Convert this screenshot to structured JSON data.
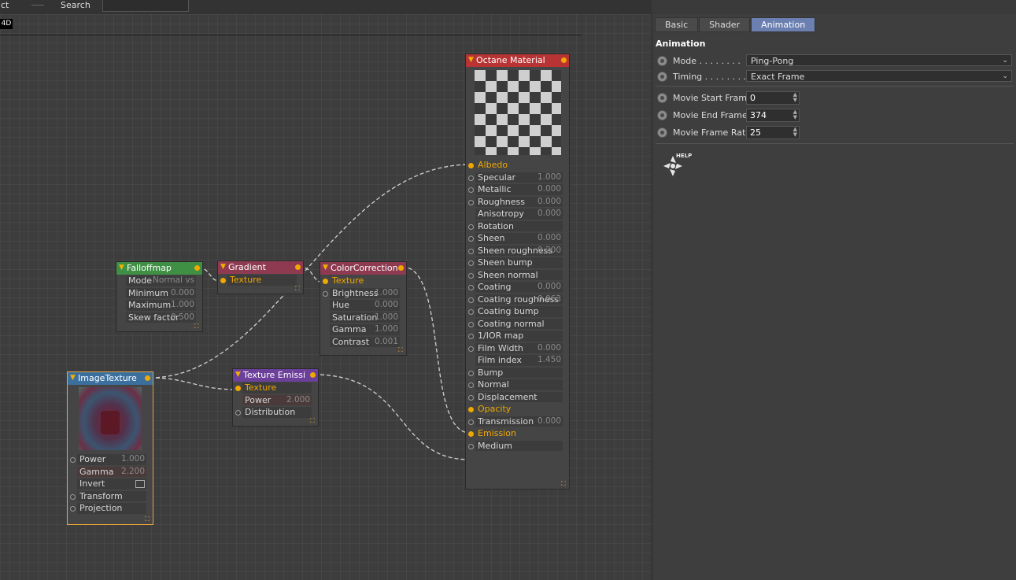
{
  "topbar": {
    "left_label": "ct",
    "search_label": "Search"
  },
  "editor": {
    "tag": "4D"
  },
  "nodes": {
    "falloff": {
      "title": "Falloffmap",
      "rows": [
        {
          "label": "Mode",
          "value": "Normal vs"
        },
        {
          "label": "Minimum",
          "value": "0.000"
        },
        {
          "label": "Maximum",
          "value": "1.000"
        },
        {
          "label": "Skew factor",
          "value": "0.500"
        }
      ]
    },
    "gradient": {
      "title": "Gradient",
      "rows": [
        {
          "label": "Texture"
        }
      ]
    },
    "colorcorr": {
      "title": "ColorCorrection",
      "rows": [
        {
          "label": "Texture"
        },
        {
          "label": "Brightness",
          "value": "1.000"
        },
        {
          "label": "Hue",
          "value": "0.000"
        },
        {
          "label": "Saturation",
          "value": "1.000"
        },
        {
          "label": "Gamma",
          "value": "1.000"
        },
        {
          "label": "Contrast",
          "value": "0.001"
        }
      ]
    },
    "imagetex": {
      "title": "ImageTexture",
      "rows": [
        {
          "label": "Power",
          "value": "1.000"
        },
        {
          "label": "Gamma",
          "value": "2.200"
        },
        {
          "label": "Invert"
        },
        {
          "label": "Transform"
        },
        {
          "label": "Projection"
        }
      ]
    },
    "texemis": {
      "title": "Texture Emissi",
      "rows": [
        {
          "label": "Texture"
        },
        {
          "label": "Power",
          "value": "2.000"
        },
        {
          "label": "Distribution"
        }
      ]
    },
    "octane": {
      "title": "Octane Material",
      "rows": [
        {
          "label": "Albedo"
        },
        {
          "label": "Specular",
          "value": "1.000"
        },
        {
          "label": "Metallic",
          "value": "0.000"
        },
        {
          "label": "Roughness",
          "value": "0.000"
        },
        {
          "label": "Anisotropy",
          "value": "0.000"
        },
        {
          "label": "Rotation"
        },
        {
          "label": "Sheen",
          "value": "0.000"
        },
        {
          "label": "Sheen roughness",
          "value": "0.200"
        },
        {
          "label": "Sheen bump"
        },
        {
          "label": "Sheen normal"
        },
        {
          "label": "Coating",
          "value": "0.000"
        },
        {
          "label": "Coating roughness",
          "value": "0.063"
        },
        {
          "label": "Coating bump"
        },
        {
          "label": "Coating normal"
        },
        {
          "label": "1/IOR map"
        },
        {
          "label": "Film Width",
          "value": "0.000"
        },
        {
          "label": "Film index",
          "value": "1.450"
        },
        {
          "label": "Bump"
        },
        {
          "label": "Normal"
        },
        {
          "label": "Displacement"
        },
        {
          "label": "Opacity"
        },
        {
          "label": "Transmission",
          "value": "0.000"
        },
        {
          "label": "Emission"
        },
        {
          "label": "Medium"
        }
      ]
    }
  },
  "panel": {
    "tabs": [
      "Basic",
      "Shader",
      "Animation"
    ],
    "section": "Animation",
    "mode_label": "Mode . . . . . . . .",
    "mode_value": "Ping-Pong",
    "timing_label": "Timing . . . . . . . .",
    "timing_value": "Exact Frame",
    "start_label": "Movie Start Frame",
    "start_value": "0",
    "end_label": "Movie End Frame",
    "end_value": "374",
    "rate_label": "Movie Frame Rate",
    "rate_value": "25",
    "help_text": "HELP"
  }
}
